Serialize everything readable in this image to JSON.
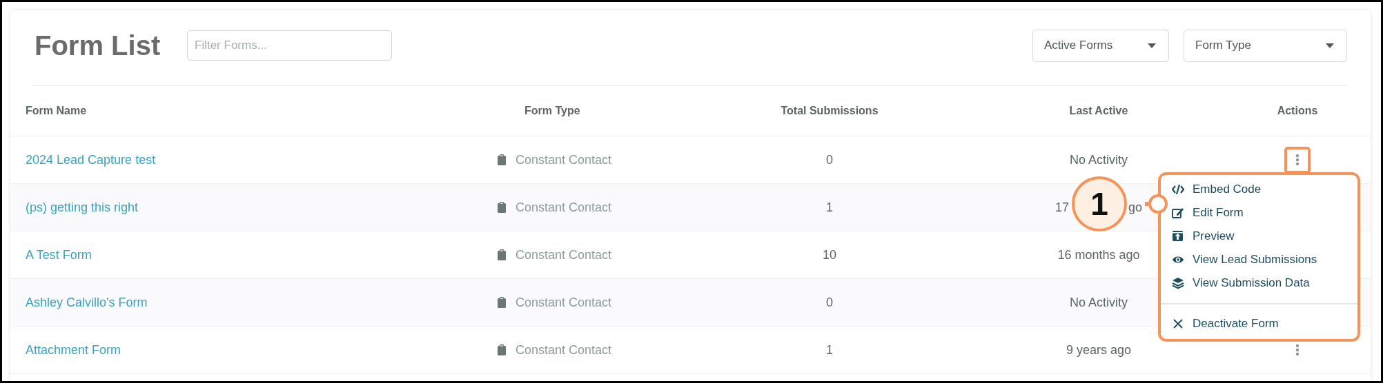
{
  "title": "Form List",
  "filter": {
    "placeholder": "Filter Forms..."
  },
  "dropdowns": [
    {
      "label": "Active Forms"
    },
    {
      "label": "Form Type"
    }
  ],
  "table": {
    "columns": [
      "Form Name",
      "Form Type",
      "Total Submissions",
      "Last Active",
      "Actions"
    ],
    "rows": [
      {
        "name": "2024 Lead Capture test",
        "form_type": "Constant Contact",
        "total": "0",
        "last_active": "No Activity",
        "menu_open": true
      },
      {
        "name": "(ps) getting this right",
        "form_type": "Constant Contact",
        "total": "1",
        "last_active": "17",
        "last_active_end": "go"
      },
      {
        "name": "A Test Form",
        "form_type": "Constant Contact",
        "total": "10",
        "last_active": "16 months ago"
      },
      {
        "name": "Ashley Calvillo's Form",
        "form_type": "Constant Contact",
        "total": "0",
        "last_active": "No Activity"
      },
      {
        "name": "Attachment Form",
        "form_type": "Constant Contact",
        "total": "1",
        "last_active": "9 years ago",
        "menu_open": false
      }
    ]
  },
  "action_menu": {
    "items": [
      {
        "kind": "code",
        "label": "Embed Code"
      },
      {
        "kind": "edit",
        "label": "Edit Form"
      },
      {
        "kind": "preview",
        "label": "Preview"
      },
      {
        "kind": "eye",
        "label": "View Lead Submissions"
      },
      {
        "kind": "layers",
        "label": "View Submission Data"
      },
      {
        "kind": "divider"
      },
      {
        "kind": "close",
        "label": "Deactivate Form"
      }
    ]
  },
  "callout": {
    "label": "1"
  }
}
